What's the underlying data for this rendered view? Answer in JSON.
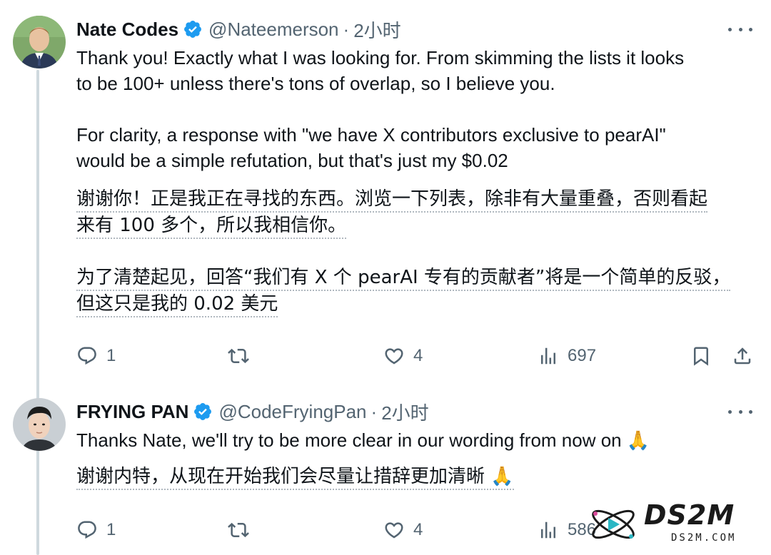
{
  "tweets": [
    {
      "display_name": "Nate Codes",
      "handle": "@Nateemerson",
      "separator": "·",
      "time": "2小时",
      "body_en": "Thank you! Exactly what I was looking for. From skimming the lists it looks\nto be 100+ unless there's tons of overlap, so I believe you.\n\nFor clarity, a response with \"we have X contributors exclusive to pearAI\"\nwould be a simple refutation, but that's just my $0.02",
      "body_zh_lines": [
        "谢谢你！正是我正在寻找的东西。浏览一下列表，除非有大量重叠，否则看起",
        "来有 100 多个，所以我相信你。",
        "",
        "为了清楚起见，回答“我们有 X 个 pearAI 专有的贡献者”将是一个简单的反驳，",
        "但这只是我的 0.02 美元"
      ],
      "replies": "1",
      "retweets": "",
      "likes": "4",
      "views": "697"
    },
    {
      "display_name": "FRYING PAN",
      "handle": "@CodeFryingPan",
      "separator": "·",
      "time": "2小时",
      "body_en": "Thanks Nate, we'll try to be more clear in our wording from now on 🙏",
      "body_zh_lines": [
        "谢谢内特，从现在开始我们会尽量让措辞更加清晰 🙏"
      ],
      "replies": "1",
      "retweets": "",
      "likes": "4",
      "views": "586"
    }
  ],
  "watermark": {
    "brand": "DS2M",
    "domain": "DS2M.COM"
  },
  "colors": {
    "text": "#0f1419",
    "secondary": "#536471",
    "verified": "#1d9bf0",
    "thread_line": "#cfd9de"
  }
}
